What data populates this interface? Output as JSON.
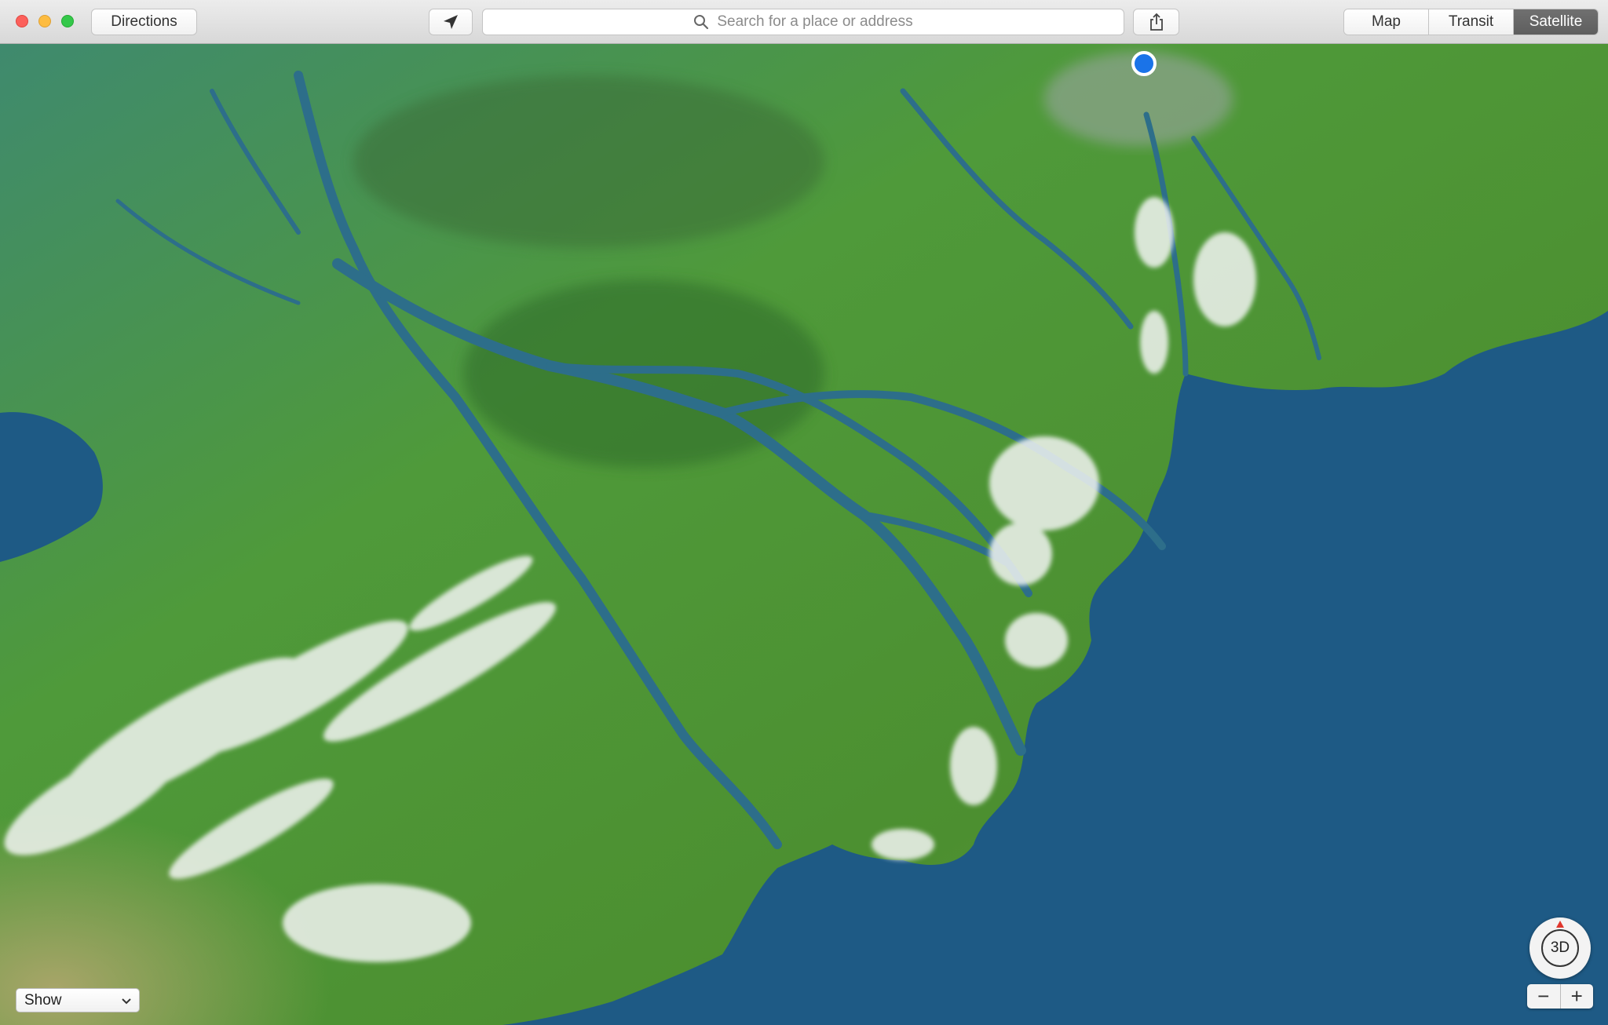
{
  "toolbar": {
    "directions_label": "Directions",
    "search_placeholder": "Search for a place or address",
    "map_types": [
      {
        "label": "Map",
        "selected": false
      },
      {
        "label": "Transit",
        "selected": false
      },
      {
        "label": "Satellite",
        "selected": true
      }
    ]
  },
  "map": {
    "view_mode": "Satellite",
    "compass_label": "3D",
    "show_menu_label": "Show",
    "zoom_out_symbol": "−",
    "zoom_in_symbol": "+"
  },
  "colors": {
    "sea": "#1e5a85",
    "land": "#4d8a35",
    "user_location": "#1a73e8",
    "segment_active": "#656565"
  }
}
